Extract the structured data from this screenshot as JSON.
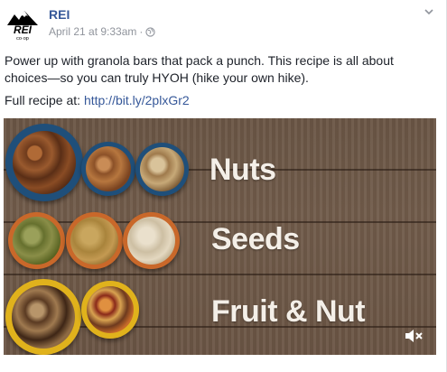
{
  "post": {
    "author": "REI",
    "timestamp": "April 21 at 9:33am",
    "separator": "·",
    "privacy_icon": "globe-icon",
    "options_icon": "chevron-down-icon",
    "avatar_logo": {
      "text": "REI",
      "subtext": "co·op"
    },
    "body_line": "Power up with granola bars that pack a punch. This recipe is all about choices—so you can truly HYOH (hike your own hike).",
    "recipe_prefix": "Full recipe at: ",
    "recipe_link": "http://bit.ly/2plxGr2"
  },
  "media": {
    "labels": [
      "Nuts",
      "Seeds",
      "Fruit & Nut"
    ],
    "mute_icon": "speaker-muted-icon",
    "colors": {
      "wood": "#6d5748",
      "blue_bowl": "#1f4f7a",
      "orange_bowl": "#c9682a",
      "yellow_bowl": "#e0b21c",
      "text": "#f4efe8"
    }
  }
}
